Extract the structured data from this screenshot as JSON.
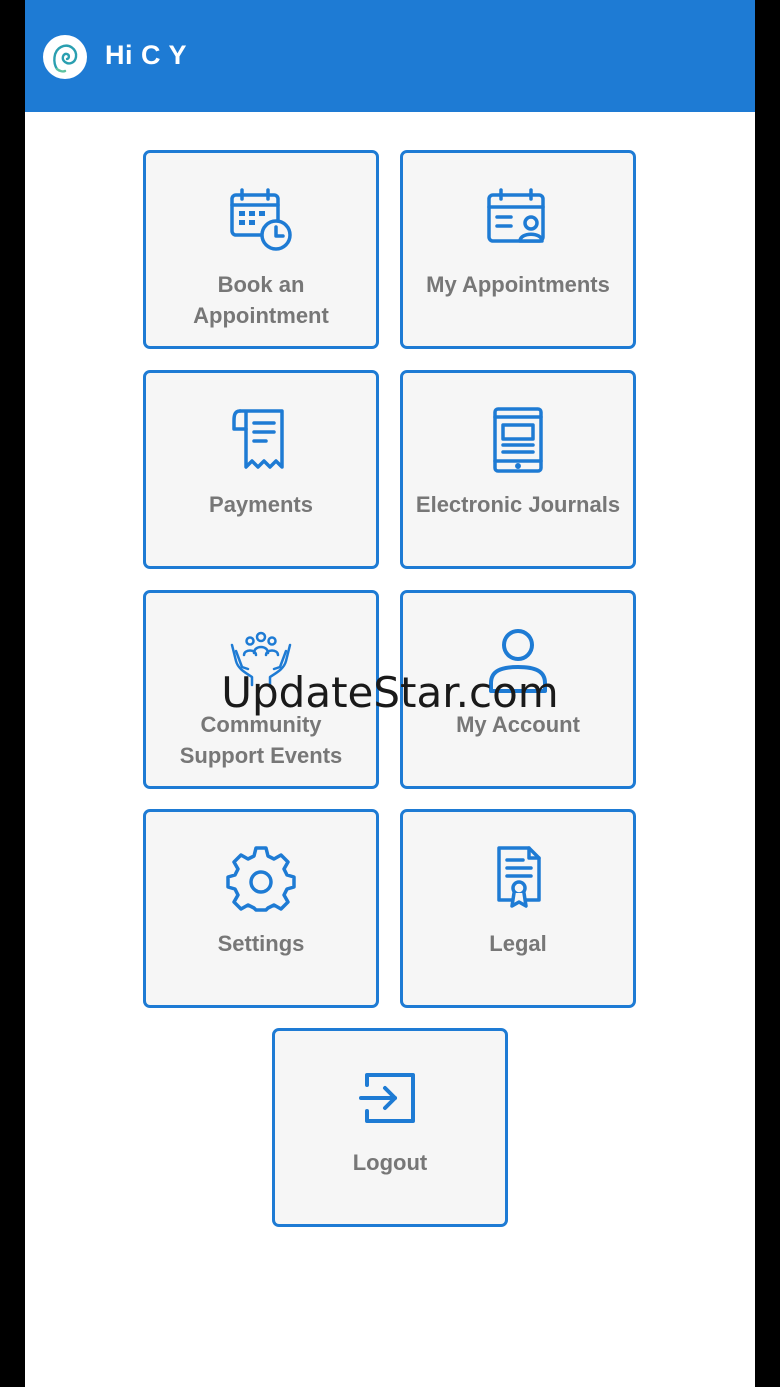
{
  "appbar": {
    "title": "Hi C Y",
    "logo_icon": "spiral-head-logo"
  },
  "tiles": [
    {
      "label": "Book an\nAppointment",
      "icon": "calendar-clock-icon"
    },
    {
      "label": "My Appointments",
      "icon": "calendar-user-icon"
    },
    {
      "label": "Payments",
      "icon": "receipt-icon"
    },
    {
      "label": "Electronic Journals",
      "icon": "tablet-icon"
    },
    {
      "label": "Community\nSupport Events",
      "icon": "community-hands-icon"
    },
    {
      "label": "My Account",
      "icon": "user-icon"
    },
    {
      "label": "Settings",
      "icon": "gear-icon"
    },
    {
      "label": "Legal",
      "icon": "certificate-icon"
    },
    {
      "label": "Logout",
      "icon": "logout-icon"
    }
  ],
  "watermark": "UpdateStar.com",
  "colors": {
    "accent": "#1e7bd4",
    "tile_bg": "#f6f6f6",
    "label": "#777777"
  }
}
